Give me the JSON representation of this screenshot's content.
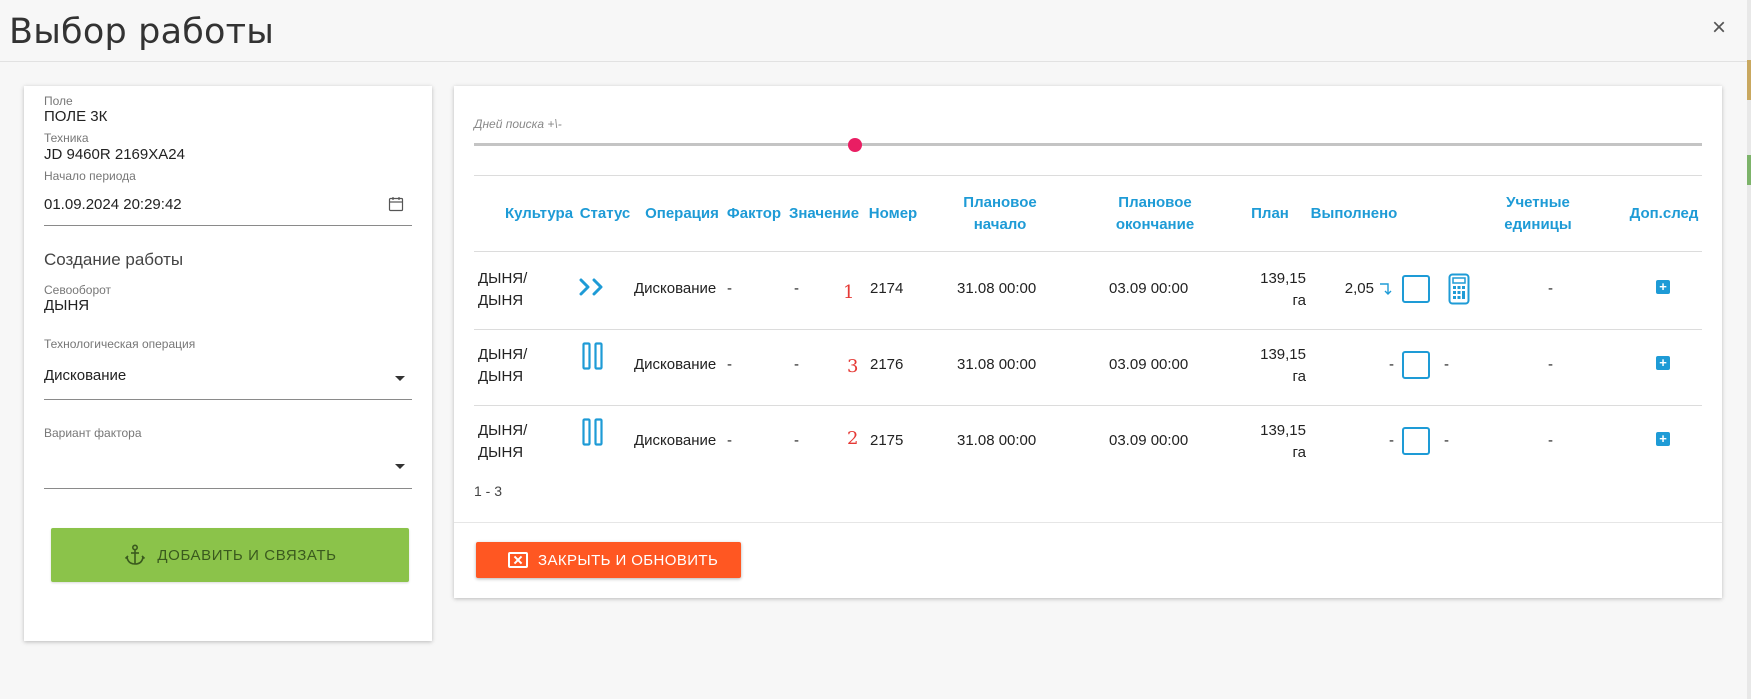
{
  "dialog": {
    "title": "Выбор работы",
    "close_symbol": "×"
  },
  "left_panel": {
    "field": {
      "label": "Поле",
      "value": "ПОЛЕ 3К"
    },
    "machinery": {
      "label": "Техника",
      "value": "JD 9460R 2169ХА24"
    },
    "period_start": {
      "label": "Начало периода",
      "value": "01.09.2024 20:29:42"
    },
    "create_section_title": "Создание работы",
    "crop_rotation": {
      "label": "Севооборот",
      "value": "ДЫНЯ"
    },
    "tech_operation": {
      "label": "Технологическая операция",
      "value": "Дискование"
    },
    "factor_variant": {
      "label": "Вариант фактора",
      "value": ""
    },
    "add_link_button": "ДОБАВИТЬ И СВЯЗАТЬ"
  },
  "right_panel": {
    "slider_label": "Дней поиска +\\-",
    "slider_level_fraction": 0.31,
    "columns": {
      "culture": "Культура",
      "status": "Статус",
      "operation": "Операция",
      "factor": "Фактор",
      "value": "Значение",
      "number": "Номер",
      "plan_start_1": "Плановое",
      "plan_start_2": "начало",
      "plan_end_1": "Плановое",
      "plan_end_2": "окончание",
      "plan": "План",
      "done": "Выполнено",
      "units_1": "Учетные",
      "units_2": "единицы",
      "extra": "Доп.след"
    },
    "rows": [
      {
        "culture_1": "ДЫНЯ/",
        "culture_2": "ДЫНЯ",
        "status_icon": "forward-icon",
        "operation": "Дискование",
        "factor": "-",
        "value": "-",
        "annotation": "1",
        "number": "2174",
        "plan_start": "31.08 00:00",
        "plan_end": "03.09 00:00",
        "plan_1": "139,15",
        "plan_2": "га",
        "done": "2,05",
        "units": "-"
      },
      {
        "culture_1": "ДЫНЯ/",
        "culture_2": "ДЫНЯ",
        "status_icon": "pause-icon",
        "operation": "Дискование",
        "factor": "-",
        "value": "-",
        "annotation": "3",
        "number": "2176",
        "plan_start": "31.08 00:00",
        "plan_end": "03.09 00:00",
        "plan_1": "139,15",
        "plan_2": "га",
        "done": "-",
        "done_after": "-",
        "units": "-"
      },
      {
        "culture_1": "ДЫНЯ/",
        "culture_2": "ДЫНЯ",
        "status_icon": "pause-icon",
        "operation": "Дискование",
        "factor": "-",
        "value": "-",
        "annotation": "2",
        "number": "2175",
        "plan_start": "31.08 00:00",
        "plan_end": "03.09 00:00",
        "plan_1": "139,15",
        "plan_2": "га",
        "done": "-",
        "done_after": "-",
        "units": "-"
      }
    ],
    "pager": "1 - 3",
    "close_refresh_button": "ЗАКРЫТЬ И ОБНОВИТЬ"
  },
  "colors": {
    "accent": "#1e9bd6",
    "green": "#8bc34a",
    "orange": "#ff5722",
    "thumb": "#e91e63",
    "annotation": "#e53935"
  }
}
